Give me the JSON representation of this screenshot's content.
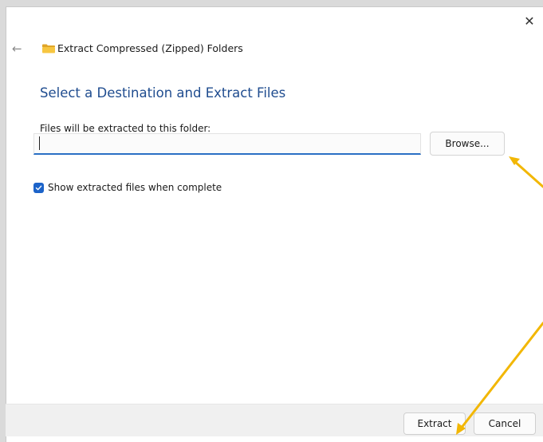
{
  "window": {
    "title": "Extract Compressed (Zipped) Folders",
    "close_glyph": "✕",
    "back_glyph": "←"
  },
  "content": {
    "heading": "Select a Destination and Extract Files",
    "instruction": "Files will be extracted to this folder:",
    "path_value": "",
    "browse_label": "Browse...",
    "show_files_label": "Show extracted files when complete",
    "show_files_checked": true
  },
  "footer": {
    "extract_label": "Extract",
    "cancel_label": "Cancel"
  },
  "icons": {
    "folder": "folder-icon",
    "back": "back-arrow-icon",
    "close": "close-icon",
    "checkmark": "checkmark-icon"
  },
  "colors": {
    "accent": "#1c63c9",
    "heading": "#1f4c8f",
    "annotation_arrow": "#f2b705"
  }
}
